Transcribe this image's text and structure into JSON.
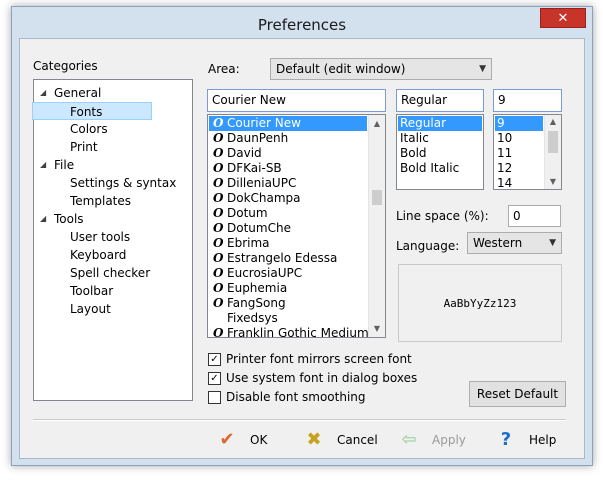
{
  "window": {
    "title": "Preferences",
    "close": "✕"
  },
  "categories": {
    "label": "Categories",
    "items": [
      {
        "label": "General",
        "group": true,
        "expanded": true
      },
      {
        "label": "Fonts",
        "selected": true
      },
      {
        "label": "Colors"
      },
      {
        "label": "Print"
      },
      {
        "label": "File",
        "group": true,
        "expanded": true
      },
      {
        "label": "Settings & syntax"
      },
      {
        "label": "Templates"
      },
      {
        "label": "Tools",
        "group": true,
        "expanded": true
      },
      {
        "label": "User tools"
      },
      {
        "label": "Keyboard"
      },
      {
        "label": "Spell checker"
      },
      {
        "label": "Toolbar"
      },
      {
        "label": "Layout"
      }
    ]
  },
  "area": {
    "label": "Area:",
    "value": "Default (edit window)"
  },
  "font": {
    "value": "Courier New",
    "list": [
      "Courier New",
      "DaunPenh",
      "David",
      "DFKai-SB",
      "DilleniaUPC",
      "DokChampa",
      "Dotum",
      "DotumChe",
      "Ebrima",
      "Estrangelo Edessa",
      "EucrosiaUPC",
      "Euphemia",
      "FangSong",
      "Fixedsys",
      "Franklin Gothic Medium"
    ],
    "no_icon": [
      "Fixedsys"
    ],
    "selected_index": 0
  },
  "style": {
    "value": "Regular",
    "list": [
      "Regular",
      "Italic",
      "Bold",
      "Bold Italic"
    ],
    "selected_index": 0
  },
  "size": {
    "value": "9",
    "list": [
      "9",
      "10",
      "11",
      "12",
      "14"
    ],
    "selected_index": 0
  },
  "line_space": {
    "label": "Line space (%):",
    "value": "0"
  },
  "language": {
    "label": "Language:",
    "value": "Western"
  },
  "preview": {
    "text": "AaBbYyZz123"
  },
  "options": [
    {
      "label": "Printer font mirrors screen font",
      "checked": true
    },
    {
      "label": "Use system font in dialog boxes",
      "checked": true
    },
    {
      "label": "Disable font smoothing",
      "checked": false
    }
  ],
  "buttons": {
    "reset": "Reset Default",
    "ok": "OK",
    "cancel": "Cancel",
    "apply": "Apply",
    "help": "Help"
  },
  "icons": {
    "ok": "checkmark-icon",
    "cancel": "x-icon",
    "apply": "arrow-left-icon",
    "help": "question-icon",
    "font_type": "opentype-icon"
  },
  "colors": {
    "ok": "#e0662a",
    "cancel": "#c8a21e",
    "help": "#1f6fc5",
    "selection": "#3399ff"
  }
}
